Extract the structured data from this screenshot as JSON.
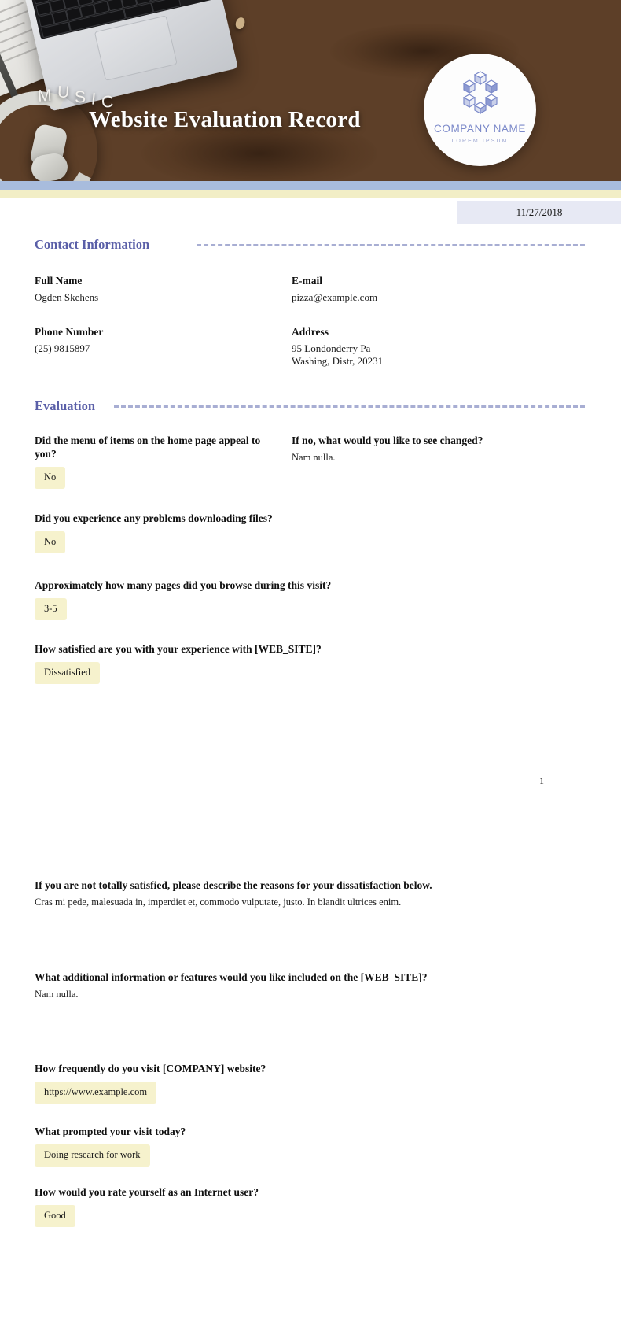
{
  "hero": {
    "decor_word": "MUSIC",
    "title": "Website Evaluation Record",
    "logo": {
      "name": "COMPANY NAME",
      "tagline": "LOREM IPSUM",
      "icon": "isometric-cubes-logo"
    }
  },
  "date": "11/27/2018",
  "colors": {
    "accent_purple": "#5a5fa8",
    "dash_rule": "#9aa0cc",
    "bar_blue": "#a8bcdd",
    "bar_yellow": "#f2eec6",
    "chip_yellow": "#f6f2cd",
    "date_badge": "#e7e9f4"
  },
  "sections": {
    "contact": {
      "title": "Contact Information",
      "fields": [
        {
          "label": "Full Name",
          "value": "Ogden Skehens"
        },
        {
          "label": "E-mail",
          "value": "pizza@example.com"
        },
        {
          "label": "Phone Number",
          "value": "(25) 9815897"
        },
        {
          "label": "Address",
          "value_line1": "95 Londonderry Pa",
          "value_line2": "Washing, Distr, 20231"
        }
      ]
    },
    "evaluation": {
      "title": "Evaluation",
      "questions": [
        {
          "text": "Did the menu of items on the home page appeal to you?",
          "chip": "No"
        },
        {
          "text": "If no, what would you like to see changed?",
          "answer": "Nam nulla."
        },
        {
          "text": "Did you experience any problems downloading files?",
          "chip": "No"
        },
        {
          "text": "Approximately how many pages did you browse during this visit?",
          "chip": "3-5"
        },
        {
          "text": "How satisfied are you with your experience with [WEB_SITE]?",
          "chip": "Dissatisfied"
        },
        {
          "text": "If you are not totally satisfied, please describe the reasons for your dissatisfaction below.",
          "answer": "Cras mi pede, malesuada in, imperdiet et, commodo vulputate, justo. In blandit ultrices enim."
        },
        {
          "text": "What additional information or features would you like included on the [WEB_SITE]?",
          "answer": "Nam nulla."
        },
        {
          "text": "How frequently do you visit [COMPANY] website?",
          "chip": "https://www.example.com"
        },
        {
          "text": "What prompted your visit today?",
          "chip": "Doing research for work"
        },
        {
          "text": "How would you rate yourself as an Internet user?",
          "chip": "Good"
        }
      ]
    }
  },
  "page_number": "1"
}
